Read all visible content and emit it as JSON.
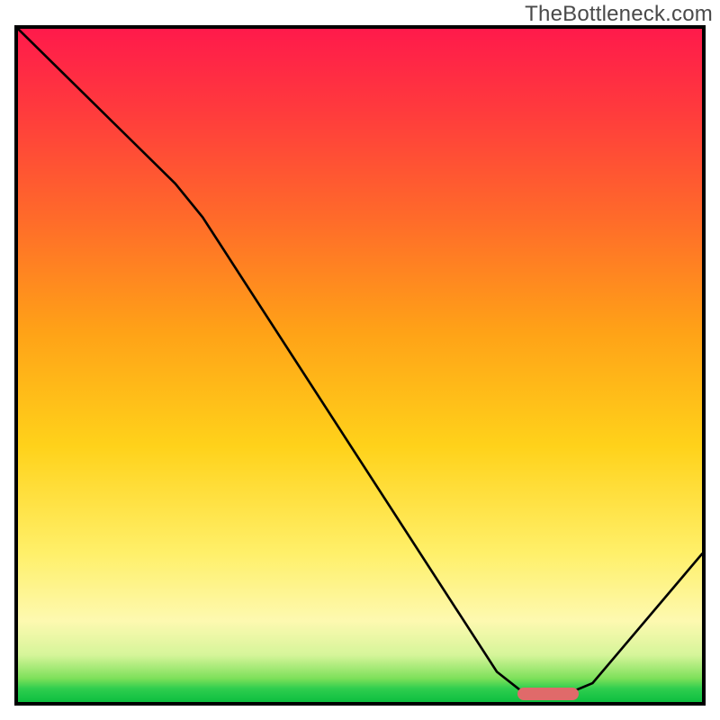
{
  "watermark": "TheBottleneck.com",
  "chart_data": {
    "type": "line",
    "title": "",
    "xlabel": "",
    "ylabel": "",
    "xlim": [
      0,
      100
    ],
    "ylim": [
      0,
      100
    ],
    "curve_points": [
      {
        "x": 0,
        "y": 100
      },
      {
        "x": 23,
        "y": 77
      },
      {
        "x": 27,
        "y": 72
      },
      {
        "x": 70,
        "y": 4.5
      },
      {
        "x": 74,
        "y": 1.3
      },
      {
        "x": 80,
        "y": 1.1
      },
      {
        "x": 84,
        "y": 2.8
      },
      {
        "x": 100,
        "y": 22
      }
    ],
    "optimal_range": {
      "start": 73,
      "end": 82,
      "y": 1.2
    },
    "gradient_stops": [
      {
        "pct": 0,
        "color": "#ff1a4b"
      },
      {
        "pct": 12,
        "color": "#ff3a3d"
      },
      {
        "pct": 28,
        "color": "#ff6a2a"
      },
      {
        "pct": 45,
        "color": "#ffa217"
      },
      {
        "pct": 62,
        "color": "#ffd21a"
      },
      {
        "pct": 78,
        "color": "#fff06a"
      },
      {
        "pct": 88,
        "color": "#fdf9b0"
      },
      {
        "pct": 93,
        "color": "#d6f59a"
      },
      {
        "pct": 96.5,
        "color": "#7de05a"
      },
      {
        "pct": 98,
        "color": "#2fce4f"
      },
      {
        "pct": 100,
        "color": "#0dbf3f"
      }
    ],
    "marker_color": "#e06a6a"
  }
}
